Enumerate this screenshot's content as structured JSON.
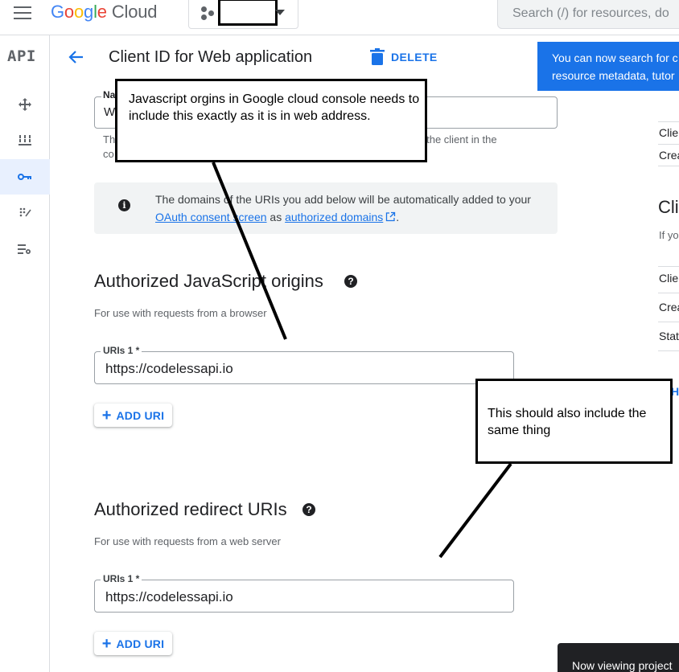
{
  "app": {
    "logo_google": "Google",
    "logo_cloud": "Cloud",
    "search_placeholder": "Search (/) for resources, do"
  },
  "rail": {
    "api_badge": "API",
    "icons": [
      "move-icon",
      "grid-icon",
      "key-icon",
      "credentials-icon",
      "settings-list-icon"
    ],
    "active": "key-icon"
  },
  "header": {
    "title": "Client ID for Web application",
    "delete_label": "DELETE"
  },
  "notice": {
    "line1": "You can now search for c",
    "line2": "resource metadata, tutor"
  },
  "name_field": {
    "label": "Na",
    "value": "We",
    "help_left_1": "Th",
    "help_right": "y the client in the",
    "help_left_2": "co"
  },
  "info": {
    "text_before": "The domains of the URIs you add below will be automatically added to your ",
    "link1": "OAuth consent screen",
    "text_middle": " as ",
    "link2": "authorized domains",
    "text_after": "."
  },
  "js_origins": {
    "title": "Authorized JavaScript origins",
    "subtitle": "For use with requests from a browser",
    "uri_label": "URIs 1 *",
    "uri_value": "https://codelessapi.io",
    "add_label": "ADD URI"
  },
  "redirect_uris": {
    "title": "Authorized redirect URIs",
    "subtitle": "For use with requests from a web server",
    "uri_label": "URIs 1 *",
    "uri_value": "https://codelessapi.io",
    "add_label": "ADD URI"
  },
  "right_panel": {
    "row1": "Clie",
    "row2": "Crea",
    "heading": "Cli",
    "sub": "If yo",
    "row3": "Clie",
    "row4": "Crea",
    "row5": "Stat",
    "link": "H"
  },
  "annotations": {
    "callout1": "Javascript orgins in Google cloud console needs to include this exactly as it is in web address.",
    "callout2": "This should also include the same thing"
  },
  "toast": "Now viewing project",
  "colors": {
    "accent": "#1a73e8",
    "notice_bg": "#1a73e8",
    "rail_active_bg": "#e8f0fe"
  }
}
